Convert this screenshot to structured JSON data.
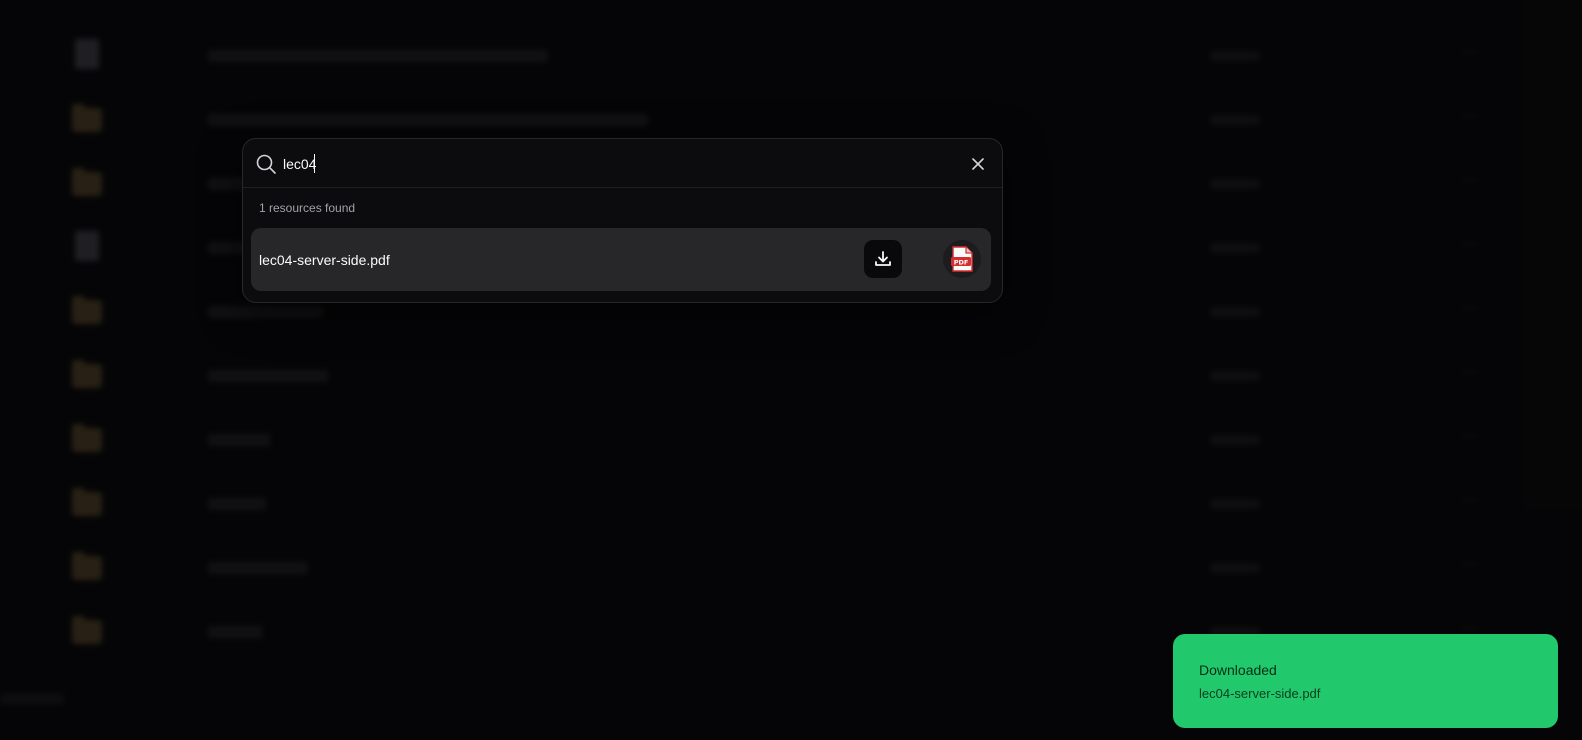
{
  "search": {
    "query": "lec04",
    "results_count_label": "1 resources found",
    "results": [
      {
        "name": "lec04-server-side.pdf",
        "type_badge": "PDF"
      }
    ]
  },
  "toast": {
    "title": "Downloaded",
    "description": "lec04-server-side.pdf"
  },
  "colors": {
    "toast_bg": "#22c96c",
    "dialog_bg": "#0c0c0e",
    "result_bg": "#27272a",
    "pdf_red": "#d32f2f"
  }
}
